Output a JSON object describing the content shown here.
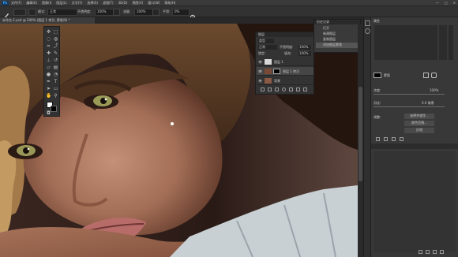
{
  "app": {
    "logo": "Ps"
  },
  "menubar": {
    "items": [
      "文件(F)",
      "编辑(E)",
      "图像(I)",
      "图层(L)",
      "文字(Y)",
      "选择(S)",
      "滤镜(T)",
      "3D(D)",
      "视图(V)",
      "窗口(W)",
      "帮助(H)"
    ],
    "window_controls": [
      "—",
      "□",
      "✕"
    ]
  },
  "options": {
    "blend_label": "模式:",
    "blend_value": "正常",
    "opacity_label": "不透明度:",
    "opacity_value": "100%",
    "flow_label": "流量:",
    "flow_value": "100%",
    "smoothing_label": "平滑:",
    "smoothing_value": "0%"
  },
  "document": {
    "tab_label": "未命名-1.psd @ 200% (图层 1 拷贝, 蒙版/8) *"
  },
  "layers_panel": {
    "title": "图层",
    "kind_label": "类型",
    "blend_value": "正常",
    "opacity_label": "不透明度:",
    "opacity_value": "100%",
    "lock_label": "锁定:",
    "fill_label": "填充:",
    "fill_value": "100%",
    "layers": [
      {
        "name": "图层 1"
      },
      {
        "name": "图层 1 拷贝"
      },
      {
        "name": "背景"
      }
    ]
  },
  "history_panel": {
    "title": "历史记录",
    "items": [
      "打开",
      "新建图层",
      "复制图层",
      "添加图层蒙版"
    ]
  },
  "properties_panel": {
    "title": "属性",
    "mask_label": "蒙版",
    "density_label": "浓度:",
    "density_value": "100%",
    "feather_label": "羽化:",
    "feather_value": "0.0 像素",
    "refine_label": "调整:",
    "buttons": [
      "选择并遮住...",
      "颜色范围...",
      "反相"
    ]
  },
  "bottom_panel": {
    "title": "路径"
  },
  "colors": {
    "accent": "#31a8ff",
    "ui_dark": "#2b2b2b",
    "panel": "#383838"
  }
}
